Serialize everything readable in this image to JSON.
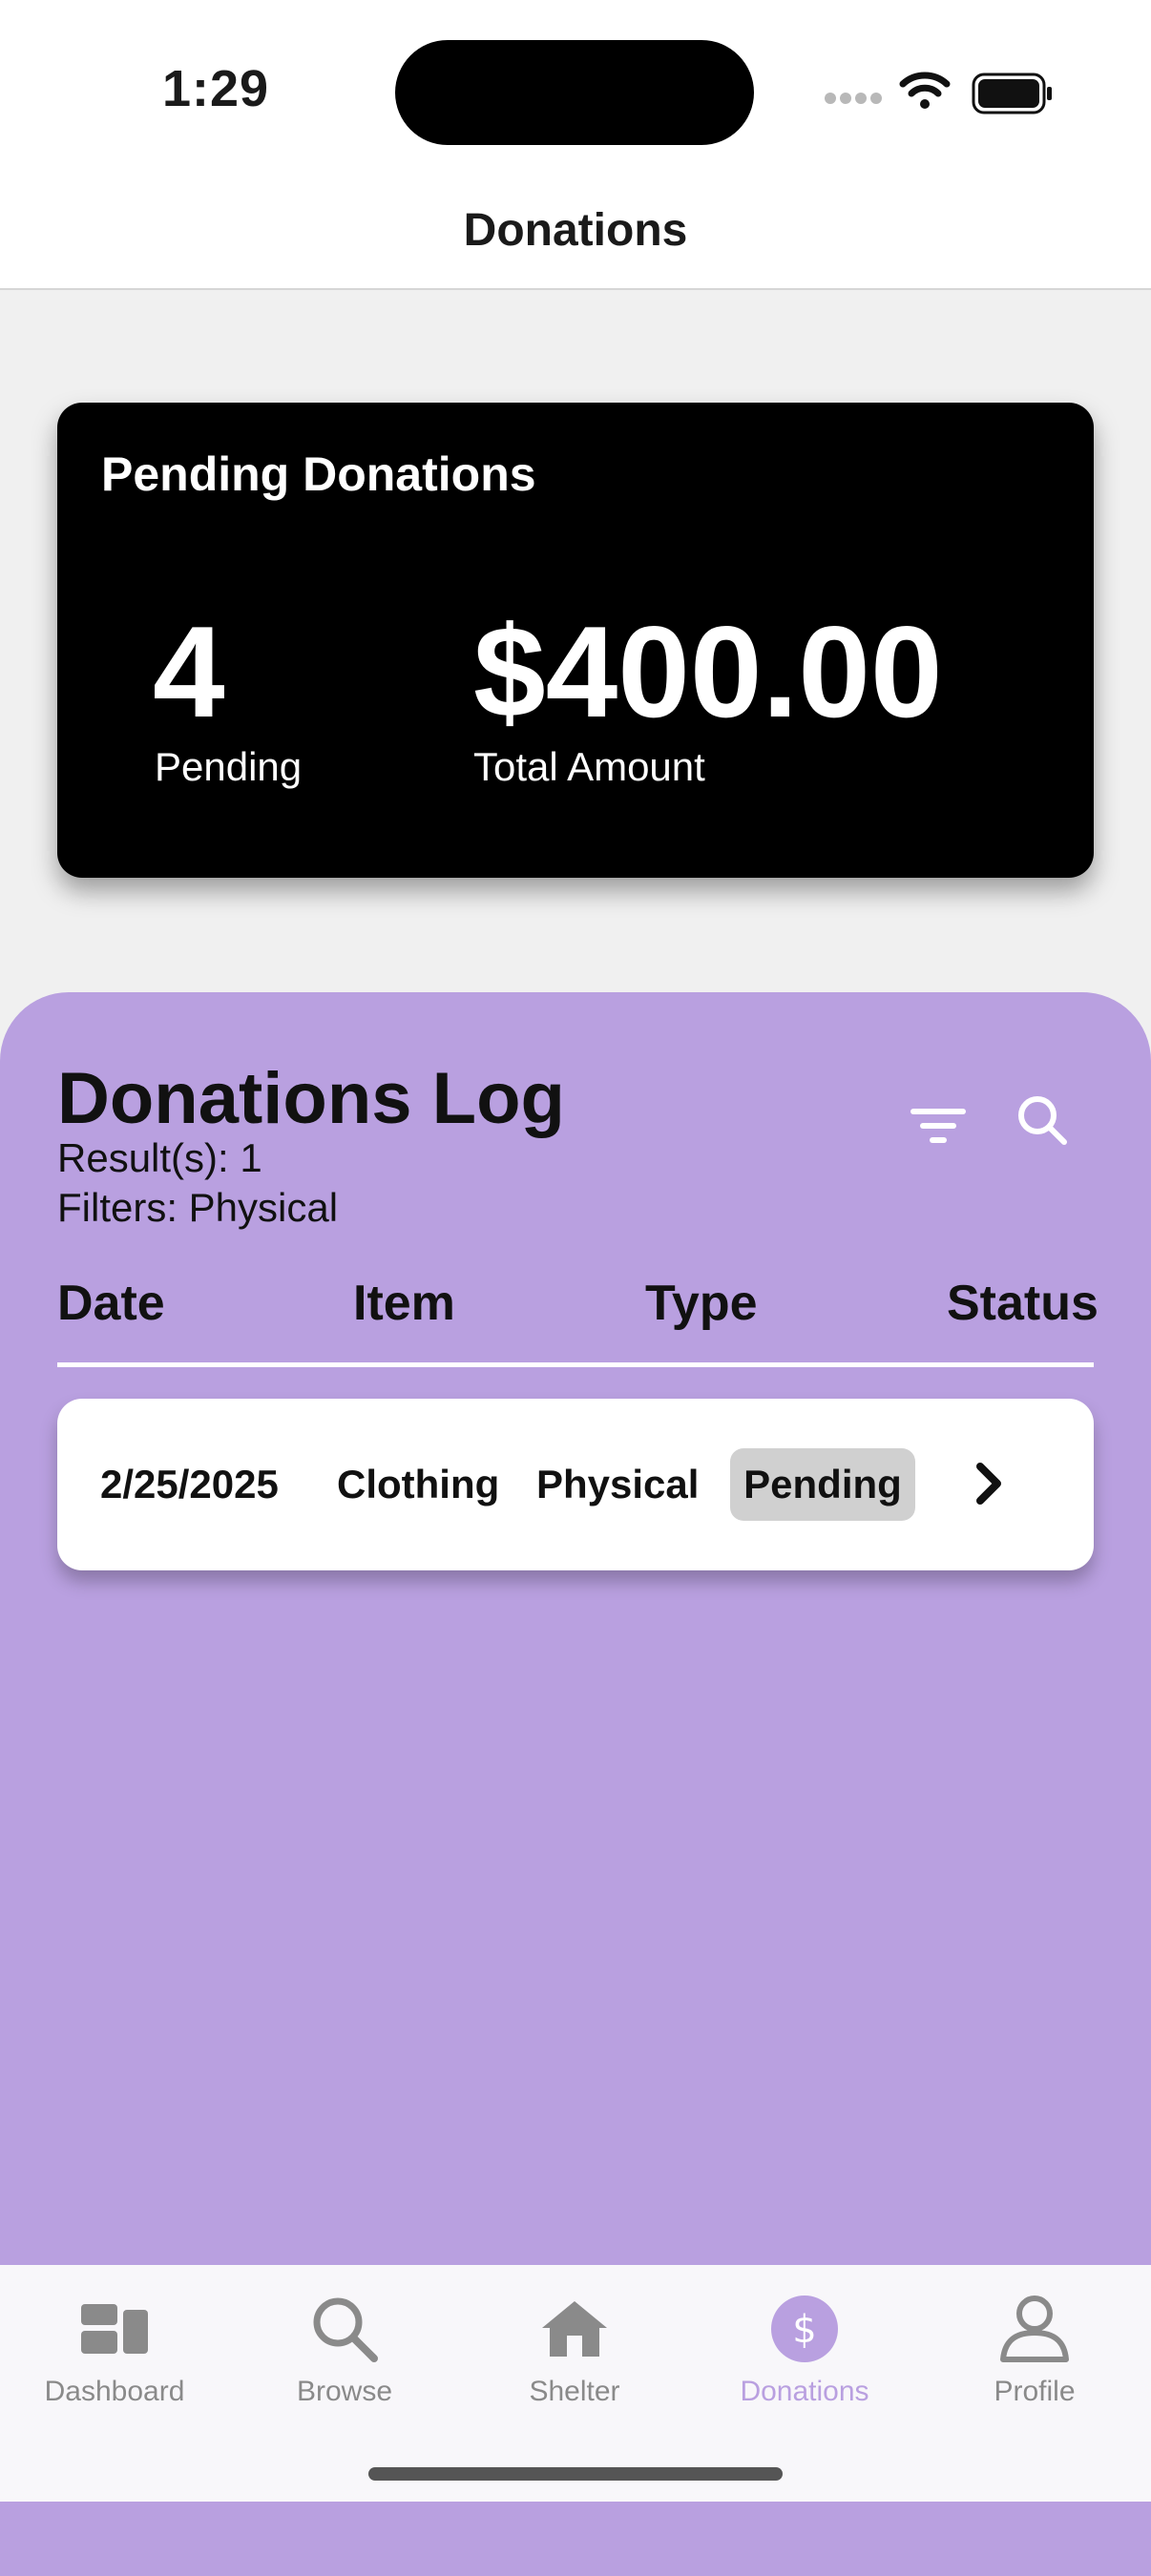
{
  "status_bar": {
    "time": "1:29"
  },
  "nav": {
    "title": "Donations"
  },
  "summary": {
    "title": "Pending Donations",
    "pending_count": "4",
    "pending_label": "Pending",
    "total_amount": "$400.00",
    "total_label": "Total Amount"
  },
  "log": {
    "title": "Donations Log",
    "results": "Result(s): 1",
    "filters": "Filters: Physical",
    "columns": [
      "Date",
      "Item",
      "Type",
      "Status"
    ],
    "rows": [
      {
        "date": "2/25/2025",
        "item": "Clothing",
        "type": "Physical",
        "status": "Pending"
      }
    ]
  },
  "tabs": [
    {
      "label": "Dashboard",
      "icon": "dashboard-icon"
    },
    {
      "label": "Browse",
      "icon": "search-icon"
    },
    {
      "label": "Shelter",
      "icon": "house-icon"
    },
    {
      "label": "Donations",
      "icon": "dollar-icon",
      "active": true
    },
    {
      "label": "Profile",
      "icon": "person-icon"
    }
  ],
  "colors": {
    "accent": "#b9a0e0",
    "card": "#000000",
    "badge": "#d0d0d0"
  }
}
